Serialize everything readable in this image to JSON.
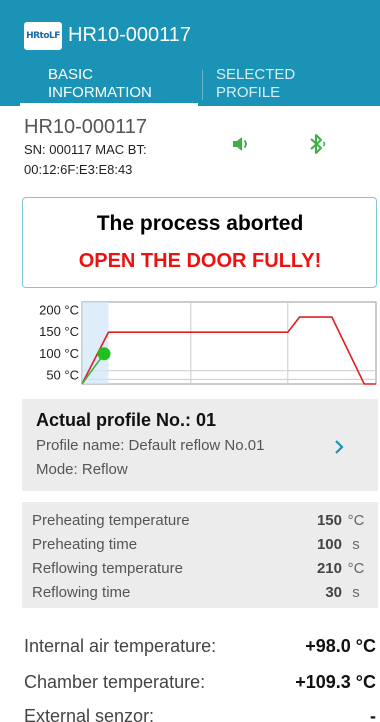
{
  "header": {
    "logo_text": "HRtoLF",
    "title": "HR10-000117",
    "tabs": [
      {
        "line1": "BASIC",
        "line2": "INFORMATION",
        "active": true
      },
      {
        "line1": "SELECTED",
        "line2": "PROFILE",
        "active": false
      }
    ],
    "color": "#1b93b6"
  },
  "device": {
    "name": "HR10-000117",
    "line1": "SN: 000117 MAC BT:",
    "line2": "00:12:6F:E3:E8:43",
    "icons": [
      "speaker-icon",
      "bluetooth-icon"
    ],
    "icon_color": "#3cb043"
  },
  "alert": {
    "title": "The process aborted",
    "message": "OPEN THE DOOR FULLY!",
    "message_color": "#ee1111"
  },
  "chart_data": {
    "type": "line",
    "y_ticks": [
      "200 °C",
      "150 °C",
      "100 °C",
      "50 °C"
    ],
    "ylim": [
      30,
      220
    ],
    "xlim": [
      0,
      100
    ],
    "series": [
      {
        "color": "#e02020",
        "x": [
          0,
          9,
          70,
          74,
          85,
          96,
          100
        ],
        "y": [
          30,
          150,
          150,
          185,
          185,
          30,
          30
        ]
      },
      {
        "color": "#3cb043",
        "x": [
          0,
          7.5
        ],
        "y": [
          30,
          100
        ]
      }
    ],
    "current_point": {
      "x": 7.5,
      "y": 100
    },
    "grid": true
  },
  "profile": {
    "title": "Actual profile No.: 01",
    "name_line": "Profile name: Default reflow No.01",
    "mode_line": "Mode: Reflow"
  },
  "settings": [
    {
      "label": "Preheating temperature",
      "value": "150",
      "unit": "°C"
    },
    {
      "label": "Preheating time",
      "value": "100",
      "unit": "s"
    },
    {
      "label": "Reflowing temperature",
      "value": "210",
      "unit": "°C"
    },
    {
      "label": "Reflowing time",
      "value": "30",
      "unit": "s"
    }
  ],
  "temperatures": [
    {
      "label": "Internal air temperature:",
      "value": "+98.0 °C"
    },
    {
      "label": "Chamber temperature:",
      "value": "+109.3 °C"
    },
    {
      "label": "External senzor:",
      "value": "-"
    }
  ]
}
